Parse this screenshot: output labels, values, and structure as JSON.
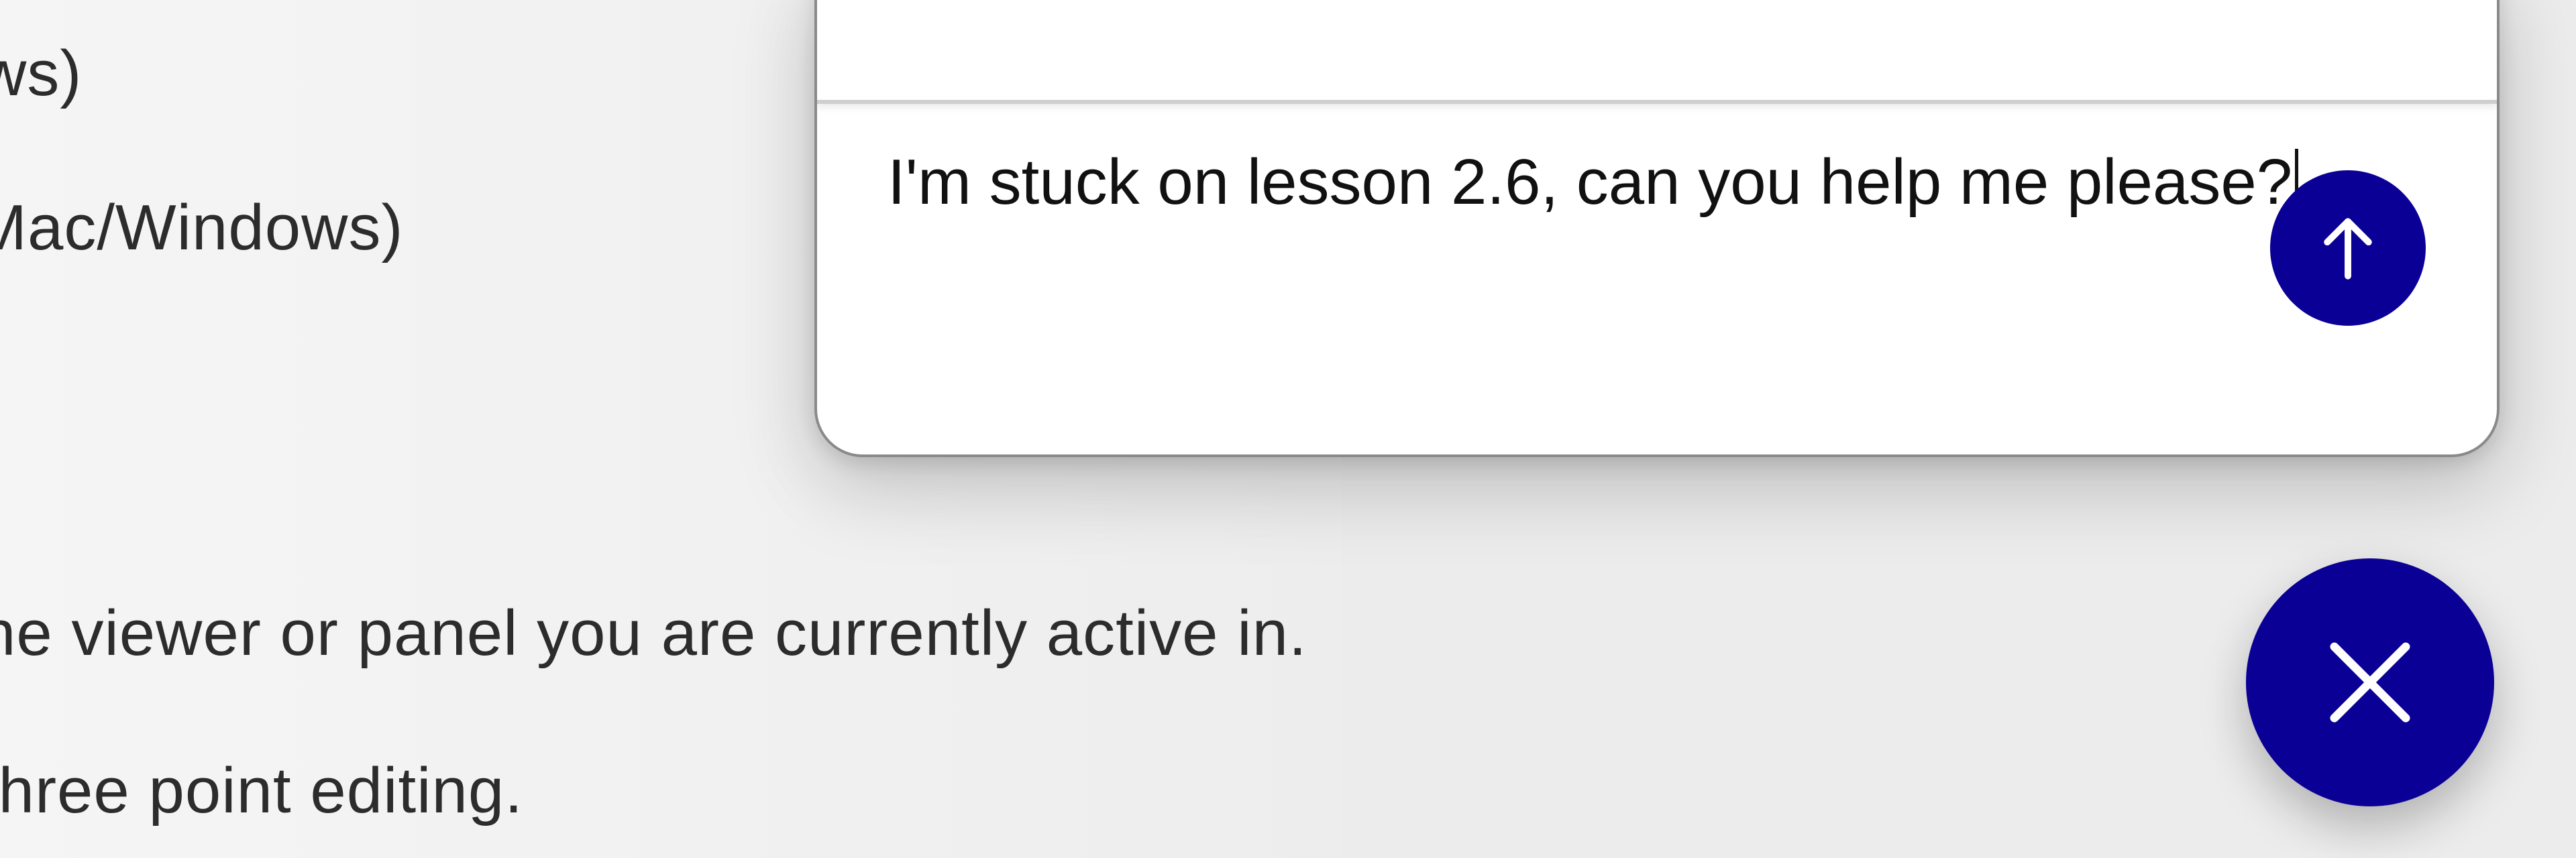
{
  "background": {
    "lines": [
      "ws)",
      "Mac/Windows)",
      "he viewer or panel you are currently active in.",
      "three point editing."
    ]
  },
  "chat": {
    "input_value": "I'm stuck on lesson 2.6, can you help me please?",
    "send_icon": "arrow-up-icon",
    "close_icon": "close-icon"
  },
  "colors": {
    "accent": "#0b0096",
    "panel_background": "#ffffff",
    "page_background": "#ececec",
    "text": "#111111"
  }
}
